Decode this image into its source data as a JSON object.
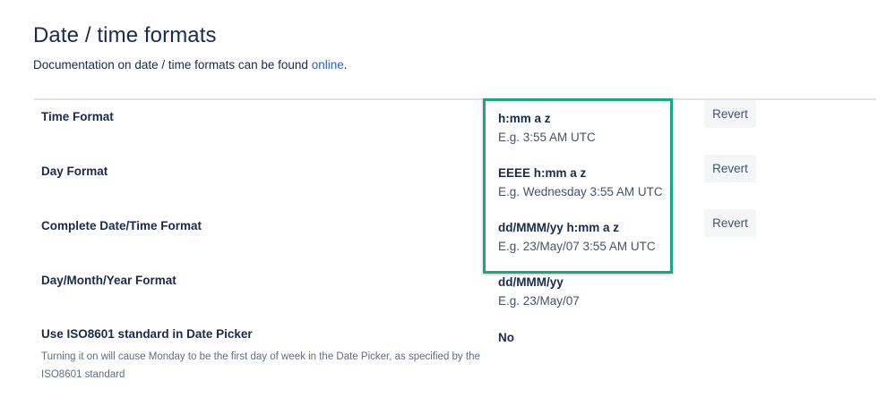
{
  "header": {
    "title": "Date / time formats",
    "doc_prefix": "Documentation on date / time formats can be found ",
    "doc_link": "online",
    "doc_suffix": "."
  },
  "rows": [
    {
      "label": "Time Format",
      "value": "h:mm a z",
      "example": "E.g. 3:55 AM UTC",
      "button": "Revert"
    },
    {
      "label": "Day Format",
      "value": "EEEE h:mm a z",
      "example": "E.g. Wednesday 3:55 AM UTC",
      "button": "Revert"
    },
    {
      "label": "Complete Date/Time Format",
      "value": "dd/MMM/yy h:mm a z",
      "example": "E.g. 23/May/07 3:55 AM UTC",
      "button": "Revert"
    },
    {
      "label": "Day/Month/Year Format",
      "value": "dd/MMM/yy",
      "example": "E.g. 23/May/07"
    },
    {
      "label": "Use ISO8601 standard in Date Picker",
      "description": "Turning it on will cause Monday to be the first day of week in the Date Picker, as specified by the ISO8601 standard",
      "value": "No"
    }
  ],
  "colors": {
    "highlight_border": "#1aa585",
    "link": "#2b5fb6",
    "button_bg": "#f4f5f7"
  }
}
